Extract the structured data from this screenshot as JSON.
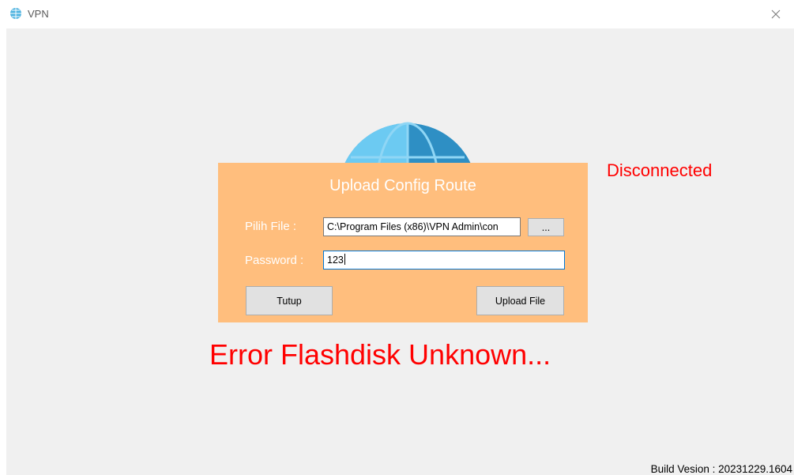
{
  "window": {
    "title": "VPN",
    "app_icon": "globe-icon",
    "close_icon": "close-icon"
  },
  "main": {
    "status_text": "Disconnected",
    "status_color": "#ff0000",
    "error_text": "Error Flashdisk Unknown...",
    "build_text": "Build Vesion : 20231229.1604"
  },
  "dialog": {
    "title": "Upload Config Route",
    "background_color": "#ffbe7d",
    "file_label": "Pilih File :",
    "file_value": "C:\\Program Files (x86)\\VPN Admin\\con",
    "browse_label": "...",
    "password_label": "Password :",
    "password_value": "123",
    "close_label": "Tutup",
    "upload_label": "Upload File"
  }
}
